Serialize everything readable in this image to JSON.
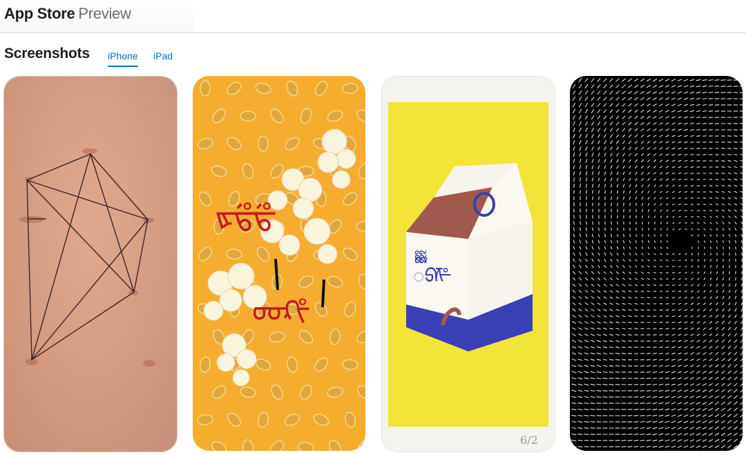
{
  "header": {
    "title_main": "App Store",
    "title_sub": "Preview"
  },
  "screenshots": {
    "heading": "Screenshots",
    "tabs": [
      {
        "label": "iPhone",
        "selected": true
      },
      {
        "label": "iPad",
        "selected": false
      }
    ]
  },
  "artworks": {
    "popcorn_text_top": "ᢘᢡᢡ",
    "popcorn_text_bottom": "ᡂᡘᡲ",
    "carton_text": "ᢅᢆᢒᢝ",
    "print_number": "6/2"
  },
  "colors": {
    "accent": "#0070c9",
    "popcorn_bg": "#f6ad2f",
    "print_yellow": "#f3e438",
    "carton_blue": "#3a3fb3",
    "carton_roof": "#a1584d"
  }
}
